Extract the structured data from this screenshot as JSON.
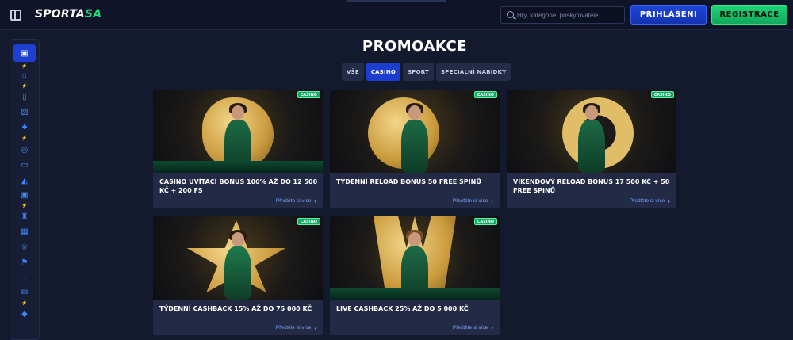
{
  "header": {
    "logo_text": "SPORTA",
    "logo_accent": "SA",
    "search_placeholder": "Hry, kategorie, poskytovatele",
    "login_label": "PŘIHLÁŠENÍ",
    "register_label": "REGISTRACE"
  },
  "sidebar": {
    "items": [
      {
        "icon": "gift-icon",
        "glyph": "🎁"
      },
      {
        "icon": "home-icon",
        "glyph": "⌂"
      },
      {
        "icon": "slot-icon",
        "glyph": "▯"
      },
      {
        "icon": "dice-icon",
        "glyph": "⚄"
      },
      {
        "icon": "clover-icon",
        "glyph": "♣"
      },
      {
        "icon": "roulette-icon",
        "glyph": "◎"
      },
      {
        "icon": "live-icon",
        "glyph": "▭"
      },
      {
        "icon": "chart-icon",
        "glyph": "◭"
      },
      {
        "icon": "tv-icon",
        "glyph": "▣"
      },
      {
        "icon": "trophy-small-icon",
        "glyph": "♜"
      },
      {
        "icon": "cards-icon",
        "glyph": "▦"
      },
      {
        "icon": "trophy-icon",
        "glyph": "♕"
      },
      {
        "icon": "flag-icon",
        "glyph": "⚑"
      },
      {
        "icon": "jackpot-icon",
        "glyph": "◔"
      },
      {
        "icon": "mail-icon",
        "glyph": "✉"
      },
      {
        "icon": "diamond-icon",
        "glyph": "◆"
      }
    ]
  },
  "main": {
    "title": "PROMOAKCE",
    "tabs": [
      {
        "label": "VŠE",
        "active": false
      },
      {
        "label": "CASINO",
        "active": true
      },
      {
        "label": "SPORT",
        "active": false
      },
      {
        "label": "SPECIÁLNÍ NABÍDKY",
        "active": false
      }
    ],
    "cards": [
      {
        "badge": "CASINO",
        "title": "CASINO UVÍTACÍ BONUS 100% AŽ DO 12 500 KČ + 200 FS",
        "more": "Přečtěte si více"
      },
      {
        "badge": "CASINO",
        "title": "TÝDENNÍ RELOAD BONUS 50 FREE SPINŮ",
        "more": "Přečtěte si více"
      },
      {
        "badge": "CASINO",
        "title": "VÍKENDOVÝ RELOAD BONUS 17 500 KČ + 50 FREE SPINŮ",
        "more": "Přečtěte si více"
      },
      {
        "badge": "CASINO",
        "title": "TÝDENNÍ CASHBACK 15% AŽ DO 75 000 KČ",
        "more": "Přečtěte si více"
      },
      {
        "badge": "CASINO",
        "title": "LIVE CASHBACK 25% AŽ DO 5 000 KČ",
        "more": "Přečtěte si více"
      }
    ]
  },
  "colors": {
    "background": "#141a2e",
    "accent_blue": "#1c3ed0",
    "accent_green": "#1fd477",
    "gold": "#d9b25a"
  }
}
